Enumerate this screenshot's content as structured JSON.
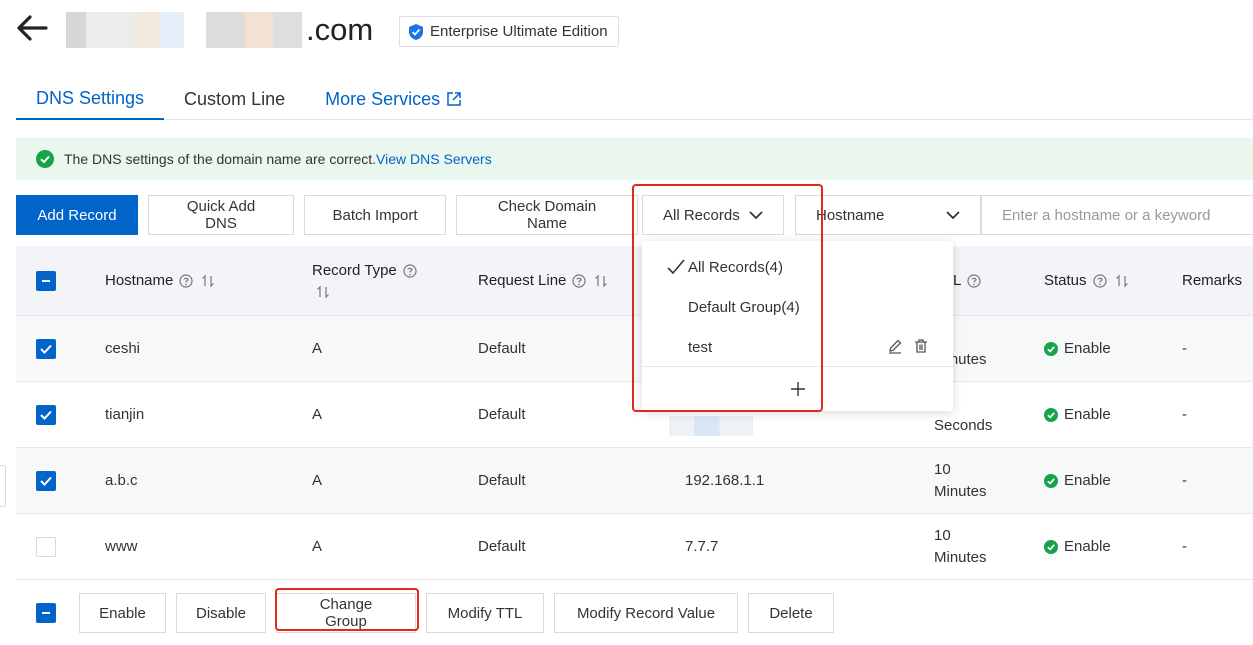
{
  "header": {
    "domain_suffix": ".com",
    "edition_badge": "Enterprise Ultimate Edition"
  },
  "tabs": [
    {
      "label": "DNS Settings",
      "active": true
    },
    {
      "label": "Custom Line",
      "active": false
    },
    {
      "label": "More Services",
      "active": false
    }
  ],
  "notice": {
    "text": "The DNS settings of the domain name are correct.",
    "link": "View DNS Servers"
  },
  "toolbar": {
    "add_record": "Add Record",
    "quick_add": "Quick Add DNS",
    "batch_import": "Batch Import",
    "check_domain": "Check Domain Name",
    "group_select": "All Records",
    "field_select": "Hostname",
    "search_placeholder": "Enter a hostname or a keyword"
  },
  "table": {
    "columns": {
      "hostname": "Hostname",
      "record_type": "Record Type",
      "request_line": "Request Line",
      "ttl_tail": "L",
      "status": "Status",
      "remarks": "Remarks"
    },
    "rows": [
      {
        "hostname": "ceshi",
        "type": "A",
        "line": "Default",
        "value": "",
        "ttl": [
          "",
          "Minutes"
        ],
        "status": "Enable",
        "remarks": "-",
        "checked": true
      },
      {
        "hostname": "tianjin",
        "type": "A",
        "line": "Default",
        "value": "",
        "ttl": [
          "",
          "Seconds"
        ],
        "status": "Enable",
        "remarks": "-",
        "checked": true
      },
      {
        "hostname": "a.b.c",
        "type": "A",
        "line": "Default",
        "value": "192.168.1.1",
        "ttl": [
          "10",
          "Minutes"
        ],
        "status": "Enable",
        "remarks": "-",
        "checked": true
      },
      {
        "hostname": "www",
        "type": "A",
        "line": "Default",
        "value": "7.7.7",
        "ttl": [
          "10",
          "Minutes"
        ],
        "status": "Enable",
        "remarks": "-",
        "checked": false
      }
    ]
  },
  "dropdown": {
    "items": [
      "All Records(4)",
      "Default Group(4)",
      "test"
    ]
  },
  "bottom_actions": {
    "enable": "Enable",
    "disable": "Disable",
    "change_group": "Change Group",
    "modify_ttl": "Modify TTL",
    "modify_value": "Modify Record Value",
    "delete": "Delete"
  },
  "colors": {
    "primary": "#0064c8",
    "success": "#17a34a",
    "highlight": "#e0281f",
    "notice_bg": "#e9f7ee"
  }
}
